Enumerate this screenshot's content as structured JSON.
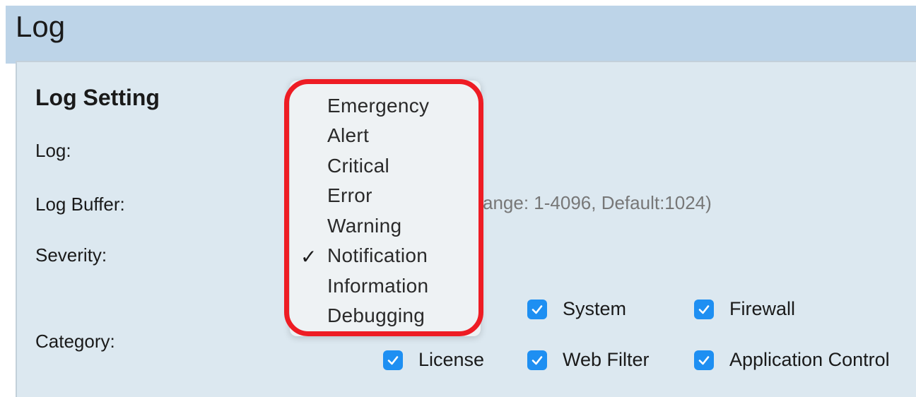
{
  "page": {
    "title": "Log"
  },
  "log_setting": {
    "section_title": "Log Setting",
    "labels": {
      "log": "Log:",
      "log_buffer": "Log Buffer:",
      "severity": "Severity:",
      "category": "Category:"
    },
    "log_buffer_hint": "ange: 1-4096, Default:1024)"
  },
  "severity_dropdown": {
    "options": [
      "Emergency",
      "Alert",
      "Critical",
      "Error",
      "Warning",
      "Notification",
      "Information",
      "Debugging"
    ],
    "selected": "Notification",
    "checkmark": "✓",
    "highlight_color": "#ee1c24"
  },
  "categories": {
    "items": [
      {
        "label": "System",
        "checked": true
      },
      {
        "label": "Firewall",
        "checked": true
      },
      {
        "label": "License",
        "checked": true
      },
      {
        "label": "Web Filter",
        "checked": true
      },
      {
        "label": "Application Control",
        "checked": true
      }
    ],
    "checkbox_color": "#1e8ff2"
  }
}
